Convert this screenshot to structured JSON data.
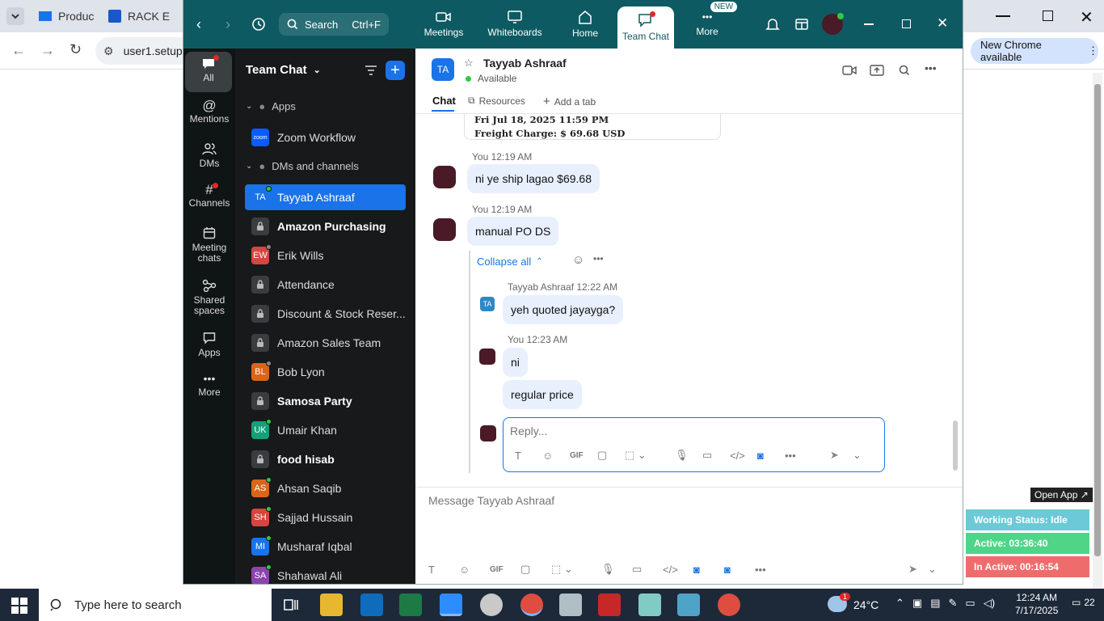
{
  "chrome": {
    "tabs": [
      "Produc",
      "RACK E"
    ],
    "address": "user1.setup",
    "update_label": "New Chrome available"
  },
  "zoom": {
    "search_label": "Search",
    "search_shortcut": "Ctrl+F",
    "nav": [
      {
        "label": "Meetings"
      },
      {
        "label": "Whiteboards"
      },
      {
        "label": "Home"
      },
      {
        "label": "Team Chat"
      },
      {
        "label": "More",
        "badge": "NEW"
      }
    ],
    "rail": [
      {
        "label": "All"
      },
      {
        "label": "Mentions"
      },
      {
        "label": "DMs"
      },
      {
        "label": "Channels"
      },
      {
        "label": "Meeting chats"
      },
      {
        "label": "Shared spaces"
      },
      {
        "label": "Apps"
      },
      {
        "label": "More"
      }
    ],
    "list_title": "Team Chat",
    "sections": {
      "apps": "Apps",
      "dms": "DMs and channels"
    },
    "apps_item": {
      "label": "Zoom Workflow",
      "icon_text": "zoom"
    },
    "items": [
      {
        "label": "Tayyab Ashraaf",
        "initials": "TA",
        "color": "#1a73e8"
      },
      {
        "label": "Amazon Purchasing",
        "initials": "",
        "color": "#3a3d3f"
      },
      {
        "label": "Erik Wills",
        "initials": "EW",
        "color": "#d6453f"
      },
      {
        "label": "Attendance",
        "initials": "",
        "color": "#3a3d3f"
      },
      {
        "label": "Discount & Stock Reser...",
        "initials": "",
        "color": "#3a3d3f"
      },
      {
        "label": "Amazon Sales Team",
        "initials": "",
        "color": "#3a3d3f"
      },
      {
        "label": "Bob Lyon",
        "initials": "BL",
        "color": "#d7661b"
      },
      {
        "label": "Samosa Party",
        "initials": "",
        "color": "#3a3d3f"
      },
      {
        "label": "Umair Khan",
        "initials": "UK",
        "color": "#15a07a"
      },
      {
        "label": "food hisab",
        "initials": "",
        "color": "#3a3d3f"
      },
      {
        "label": "Ahsan Saqib",
        "initials": "AS",
        "color": "#d7661b"
      },
      {
        "label": "Sajjad Hussain",
        "initials": "SH",
        "color": "#d6453f"
      },
      {
        "label": "Musharaf Iqbal",
        "initials": "MI",
        "color": "#1a73e8"
      },
      {
        "label": "Shahawal Ali",
        "initials": "SA",
        "color": "#8e44ad"
      }
    ],
    "chat": {
      "name": "Tayyab Ashraaf",
      "initials": "TA",
      "status": "Available",
      "tabs": [
        "Chat",
        "Resources",
        "Add a tab"
      ],
      "card_line1": "Fri Jul 18, 2025 11:59 PM",
      "card_line2": "Freight Charge: $ 69.68 USD",
      "msg1_meta": "You 12:19 AM",
      "msg1": "ni ye ship lagao $69.68",
      "msg2_meta": "You 12:19 AM",
      "msg2": "manual PO DS",
      "collapse": "Collapse all",
      "reply1_meta": "Tayyab Ashraaf 12:22 AM",
      "reply1": "yeh quoted jayayga?",
      "reply2_meta": "You 12:23 AM",
      "reply2a": "ni",
      "reply2b": "regular price",
      "reply_placeholder": "Reply...",
      "compose_placeholder": "Message Tayyab Ashraaf",
      "gif": "GIF"
    }
  },
  "widget": {
    "open_app": "Open App ↗",
    "status": "Working Status: Idle",
    "active": "Active: 03:36:40",
    "inactive": "In Active: 00:16:54"
  },
  "taskbar": {
    "search": "Type here to search",
    "weather": "24°C",
    "weather_badge": "1",
    "time": "12:24 AM",
    "date": "7/17/2025",
    "notif": "22"
  },
  "colors": {
    "zoom_header": "#0e5a62",
    "zoom_blue": "#1a73e8",
    "bubble": "#e8f0fe"
  }
}
